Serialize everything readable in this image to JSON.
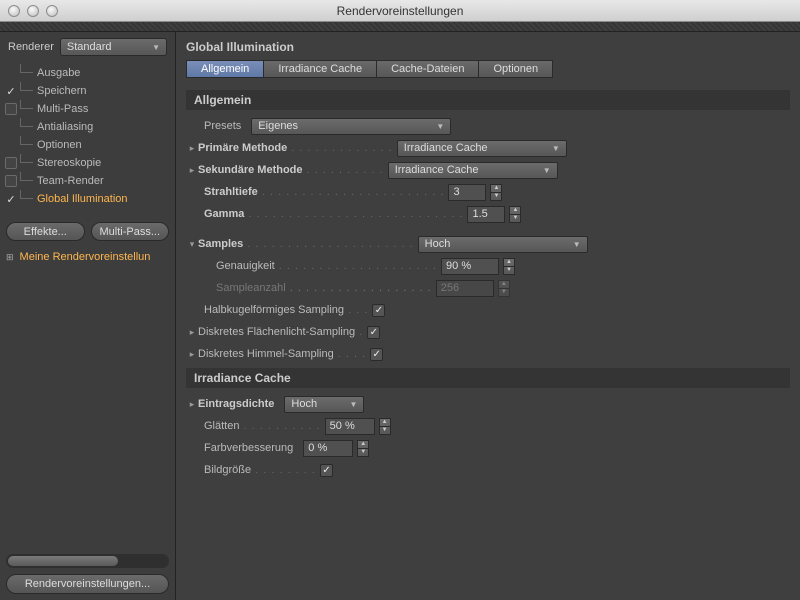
{
  "window": {
    "title": "Rendervoreinstellungen"
  },
  "sidebar": {
    "renderer_label": "Renderer",
    "renderer_value": "Standard",
    "items": [
      {
        "label": "Ausgabe",
        "check": ""
      },
      {
        "label": "Speichern",
        "check": "✓"
      },
      {
        "label": "Multi-Pass",
        "check": "box"
      },
      {
        "label": "Antialiasing",
        "check": ""
      },
      {
        "label": "Optionen",
        "check": ""
      },
      {
        "label": "Stereoskopie",
        "check": "box"
      },
      {
        "label": "Team-Render",
        "check": "box"
      },
      {
        "label": "Global Illumination",
        "check": "✓",
        "selected": true
      }
    ],
    "effects_btn": "Effekte...",
    "multipass_btn": "Multi-Pass...",
    "preset_label": "Meine Rendervoreinstellun",
    "bottom_btn": "Rendervoreinstellungen..."
  },
  "panel": {
    "title": "Global Illumination",
    "tabs": [
      "Allgemein",
      "Irradiance Cache",
      "Cache-Dateien",
      "Optionen"
    ],
    "active_tab": 0,
    "allgemein": {
      "heading": "Allgemein",
      "presets_label": "Presets",
      "presets_value": "Eigenes",
      "primary_label": "Primäre Methode",
      "primary_value": "Irradiance Cache",
      "secondary_label": "Sekundäre Methode",
      "secondary_value": "Irradiance Cache",
      "depth_label": "Strahltiefe",
      "depth_value": "3",
      "gamma_label": "Gamma",
      "gamma_value": "1.5",
      "samples_label": "Samples",
      "samples_value": "Hoch",
      "accuracy_label": "Genauigkeit",
      "accuracy_value": "90 %",
      "sampcount_label": "Sampleanzahl",
      "sampcount_value": "256",
      "hemi_label": "Halbkugelförmiges Sampling",
      "area_label": "Diskretes Flächenlicht-Sampling",
      "sky_label": "Diskretes Himmel-Sampling"
    },
    "irr": {
      "heading": "Irradiance Cache",
      "density_label": "Eintragsdichte",
      "density_value": "Hoch",
      "smooth_label": "Glätten",
      "smooth_value": "50 %",
      "color_label": "Farbverbesserung",
      "color_value": "0 %",
      "size_label": "Bildgröße"
    }
  }
}
